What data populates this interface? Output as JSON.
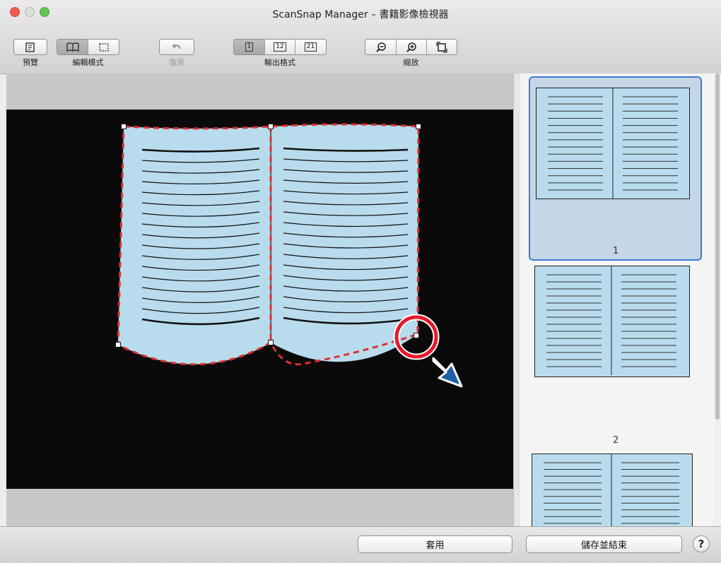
{
  "window": {
    "title": "ScanSnap Manager – 書籍影像檢視器"
  },
  "toolbar": {
    "preview": {
      "label": "預覽",
      "icon": "preview-icon"
    },
    "edit_mode": {
      "label": "編輯模式",
      "icons": [
        "book-mode-icon",
        "crop-mode-icon"
      ]
    },
    "undo": {
      "label": "復原",
      "icon": "undo-icon",
      "enabled": false
    },
    "output_format": {
      "label": "輸出格式",
      "options": [
        "1",
        "12",
        "21"
      ],
      "selected": "1"
    },
    "zoom": {
      "label": "縮放",
      "icons": [
        "zoom-out-icon",
        "zoom-in-icon",
        "fit-icon"
      ]
    }
  },
  "thumbnails": {
    "page_numbers": [
      "1",
      "2"
    ],
    "selected": "1"
  },
  "buttons": {
    "apply": "套用",
    "save_exit": "儲存並結束",
    "help": "?"
  },
  "colors": {
    "page_fill": "#b8dced",
    "crop_outline": "#e03030",
    "highlight_circle": "#e8192c",
    "arrow": "#1f5fa8",
    "selection_border": "#3a7bd5"
  }
}
